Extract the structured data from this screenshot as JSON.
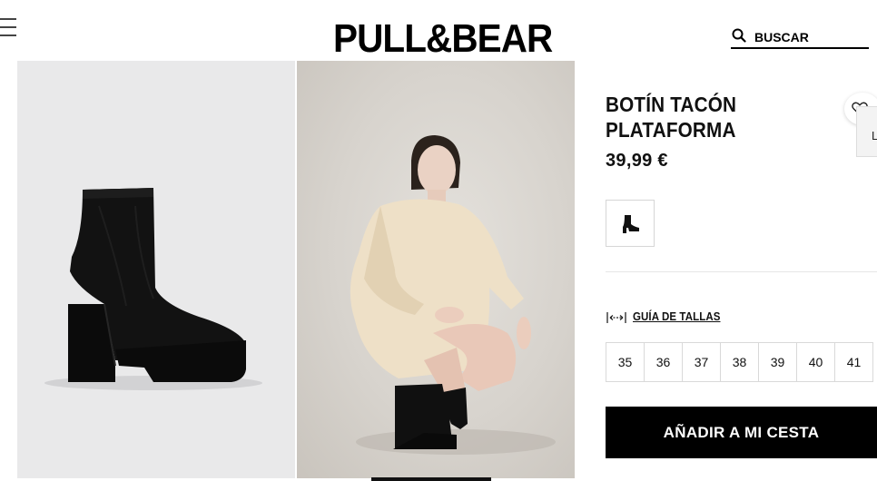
{
  "header": {
    "logo": "PULL&BEAR",
    "search_placeholder": "BUSCAR"
  },
  "product": {
    "title_line1": "BOTÍN TACÓN",
    "title_line2": "PLATAFORMA",
    "price": "39,99 €",
    "side_tab": "L",
    "size_guide_label": "GUÍA DE TALLAS",
    "sizes": [
      "35",
      "36",
      "37",
      "38",
      "39",
      "40",
      "41"
    ],
    "add_to_cart_label": "AÑADIR A MI CESTA"
  },
  "icons": {
    "menu": "hamburger-icon",
    "search": "search-icon",
    "favorite": "heart-icon",
    "swatch": "boot-icon",
    "size_guide": "ruler-icon"
  },
  "colors": {
    "brand_black": "#000000",
    "image_bg": "#e9e9ea",
    "border": "#d9d9d9"
  }
}
